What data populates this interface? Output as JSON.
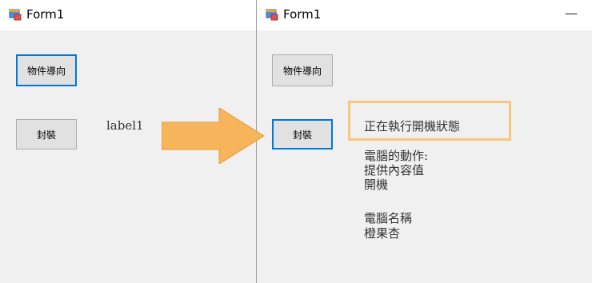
{
  "watermark": "橙 果 杏",
  "left_window": {
    "title": "Form1",
    "buttons": {
      "oop": "物件導向",
      "encap": "封裝"
    },
    "label": "label1"
  },
  "right_window": {
    "title": "Form1",
    "minimize_glyph": "—",
    "buttons": {
      "oop": "物件導向",
      "encap": "封裝"
    },
    "output": {
      "status": "正在執行開機狀態",
      "actions_title": "電腦的動作:",
      "action_1": "提供內容值",
      "action_2": "開機",
      "name_title": "電腦名稱",
      "name_value": "橙果杏"
    }
  },
  "colors": {
    "arrow": "#f6b55a",
    "highlight": "#f9c77a",
    "focus": "#0078d7"
  }
}
